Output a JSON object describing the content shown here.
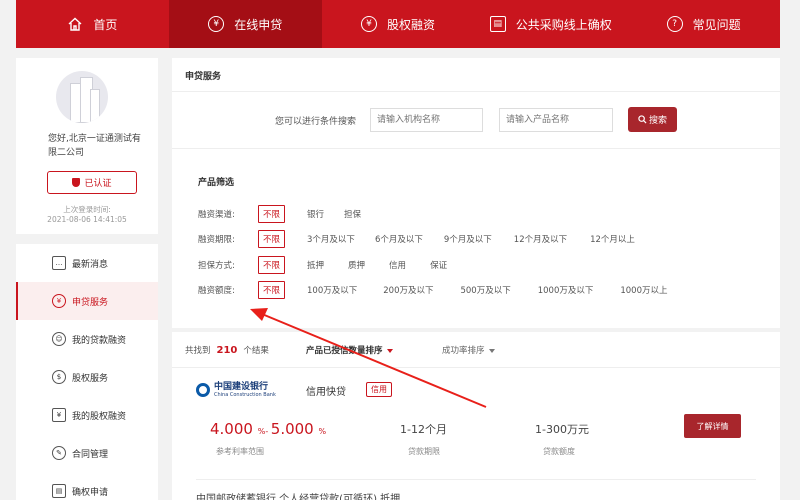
{
  "nav": {
    "items": [
      {
        "label": "首页",
        "icon": "home-icon",
        "glyph": "⌂"
      },
      {
        "label": "在线申贷",
        "icon": "yen-coin-icon",
        "glyph": "¥"
      },
      {
        "label": "股权融资",
        "icon": "yen-circle-icon",
        "glyph": "¥"
      },
      {
        "label": "公共采购线上确权",
        "icon": "document-icon",
        "glyph": "▤"
      },
      {
        "label": "常见问题",
        "icon": "question-icon",
        "glyph": "?"
      }
    ],
    "active_index": 1
  },
  "profile": {
    "greeting": "您好,北京一证通测试有限二公司",
    "cert_label": "已认证",
    "last_login_label": "上次登录时间:",
    "last_login_time": "2021-08-06 14:41:05"
  },
  "menu": {
    "items": [
      {
        "label": "最新消息",
        "icon": "message-icon",
        "glyph": "…"
      },
      {
        "label": "申贷服务",
        "icon": "yen-icon",
        "glyph": "¥"
      },
      {
        "label": "我的贷款融资",
        "icon": "user-money-icon",
        "glyph": "☺"
      },
      {
        "label": "股权服务",
        "icon": "money-bag-icon",
        "glyph": "$"
      },
      {
        "label": "我的股权融资",
        "icon": "equity-icon",
        "glyph": "¥"
      },
      {
        "label": "合同管理",
        "icon": "contract-icon",
        "glyph": "✎"
      },
      {
        "label": "确权申请",
        "icon": "apply-icon",
        "glyph": "▤"
      }
    ],
    "active_index": 1
  },
  "main": {
    "section_title": "申贷服务",
    "search": {
      "hint": "您可以进行条件搜索",
      "org_placeholder": "请输入机构名称",
      "product_placeholder": "请输入产品名称",
      "button_label": "搜索"
    },
    "filter": {
      "title": "产品筛选",
      "rows": [
        {
          "label": "融资渠道:",
          "options": [
            "不限",
            "银行",
            "担保"
          ]
        },
        {
          "label": "融资期限:",
          "options": [
            "不限",
            "3个月及以下",
            "6个月及以下",
            "9个月及以下",
            "12个月及以下",
            "12个月以上"
          ]
        },
        {
          "label": "担保方式:",
          "options": [
            "不限",
            "抵押",
            "质押",
            "信用",
            "保证"
          ]
        },
        {
          "label": "融资额度:",
          "options": [
            "不限",
            "100万及以下",
            "200万及以下",
            "500万及以下",
            "1000万及以下",
            "1000万以上"
          ]
        }
      ]
    },
    "results": {
      "found_prefix": "共找到",
      "found_count": "210",
      "found_suffix": "个结果",
      "sort_primary": "产品已授信数量排序",
      "sort_secondary": "成功率排序"
    },
    "product": {
      "bank_cn": "中国建设银行",
      "bank_en": "China Construction Bank",
      "name": "信用快贷",
      "tag": "信用",
      "rate_low": "4.000",
      "rate_high": "5.000",
      "rate_unit": "%",
      "rate_sep": "- ",
      "rate_label": "参考利率范围",
      "term": "1-12个月",
      "term_label": "贷款期限",
      "amount": "1-300万元",
      "amount_label": "贷款额度",
      "detail_button": "了解详情"
    },
    "next_product_peek": "中国邮政储蓄银行   个人经营贷款(可循环)   抵押"
  },
  "colors": {
    "brand": "#c9151e",
    "brand_dark": "#a40e15",
    "button": "#a8262c",
    "annotation_arrow": "#e8201a"
  }
}
